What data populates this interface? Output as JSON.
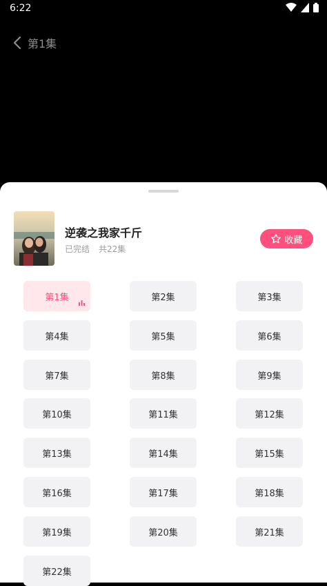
{
  "status": {
    "time": "6:22"
  },
  "header": {
    "title": "第1集"
  },
  "drama": {
    "title": "逆袭之我家千斤",
    "status": "已完结",
    "count": "共22集",
    "favorite_label": "收藏"
  },
  "episodes": [
    {
      "label": "第1集",
      "active": true
    },
    {
      "label": "第2集"
    },
    {
      "label": "第3集"
    },
    {
      "label": "第4集"
    },
    {
      "label": "第5集"
    },
    {
      "label": "第6集"
    },
    {
      "label": "第7集"
    },
    {
      "label": "第8集"
    },
    {
      "label": "第9集"
    },
    {
      "label": "第10集"
    },
    {
      "label": "第11集"
    },
    {
      "label": "第12集"
    },
    {
      "label": "第13集"
    },
    {
      "label": "第14集"
    },
    {
      "label": "第15集"
    },
    {
      "label": "第16集"
    },
    {
      "label": "第17集"
    },
    {
      "label": "第18集"
    },
    {
      "label": "第19集"
    },
    {
      "label": "第20集"
    },
    {
      "label": "第21集"
    },
    {
      "label": "第22集"
    }
  ],
  "colors": {
    "accent": "#ff4f7c",
    "active_bg": "#ffe7ec",
    "tile_bg": "#f2f2f4"
  },
  "icons": {
    "back": "chevron-left-icon",
    "favorite": "star-outline-icon",
    "playing": "equalizer-icon"
  }
}
